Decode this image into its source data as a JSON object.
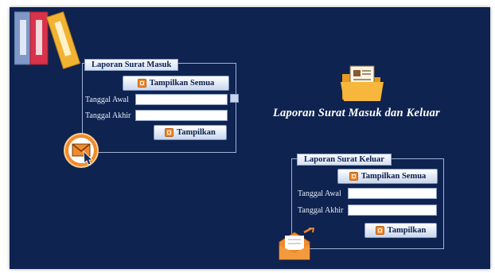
{
  "main": {
    "title": "Laporan Surat Masuk dan Keluar"
  },
  "surat_masuk": {
    "legend": "Laporan Surat Masuk",
    "show_all_label": "Tampilkan Semua",
    "start_label": "Tanggal Awal",
    "end_label": "Tanggal Akhir",
    "start_value": "",
    "end_value": "",
    "show_label": "Tampilkan"
  },
  "surat_keluar": {
    "legend": "Laporan Surat Keluar",
    "show_all_label": "Tampilkan Semua",
    "start_label": "Tanggal Awal",
    "end_label": "Tanggal Akhir",
    "start_value": "",
    "end_value": "",
    "show_label": "Tampilkan"
  },
  "icons": {
    "binders": "binders-icon",
    "folder": "folder-document-icon",
    "mail_in": "mail-inbox-icon",
    "mail_out": "mail-send-icon"
  },
  "colors": {
    "background": "#0e2350",
    "accent": "#f08a2c",
    "panel_border": "#9fb3d6"
  }
}
